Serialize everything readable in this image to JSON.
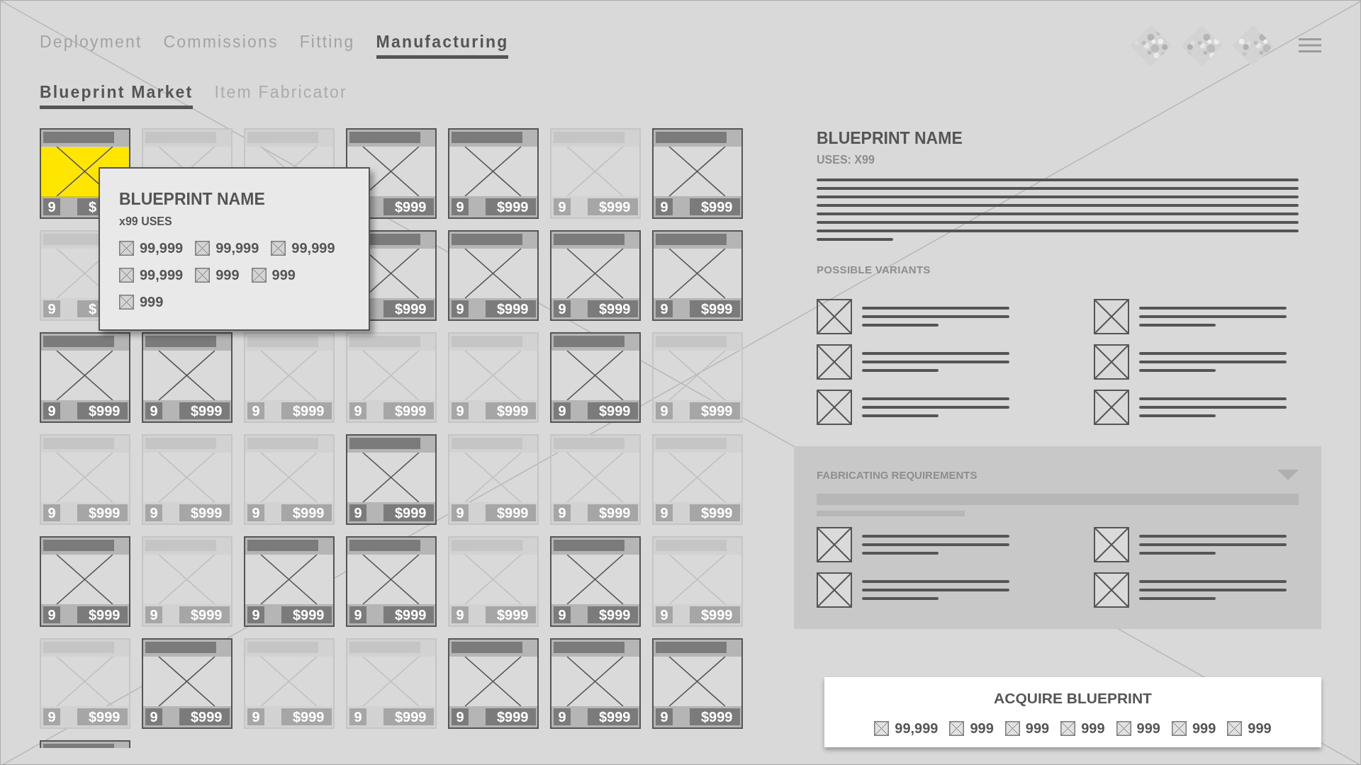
{
  "tabs": [
    {
      "label": "Deployment",
      "selected": false
    },
    {
      "label": "Commissions",
      "selected": false
    },
    {
      "label": "Fitting",
      "selected": false
    },
    {
      "label": "Manufacturing",
      "selected": true
    }
  ],
  "sub_tabs": [
    {
      "label": "Blueprint Market",
      "selected": true
    },
    {
      "label": "Item Fabricator",
      "selected": false
    }
  ],
  "blueprint_grid": {
    "rows": [
      [
        {
          "available": true,
          "selected": true,
          "count": "9",
          "price": "$"
        },
        {
          "available": false,
          "selected": false
        },
        {
          "available": false,
          "selected": false
        },
        {
          "available": true,
          "selected": false,
          "price": "$999"
        },
        {
          "available": true,
          "selected": false,
          "count": "9",
          "price": "$999"
        },
        {
          "available": false,
          "selected": false,
          "count": "9",
          "price": "$999"
        },
        {
          "available": true,
          "selected": false,
          "count": "9",
          "price": "$999"
        }
      ],
      [
        {
          "available": false,
          "selected": false,
          "count": "9",
          "price": "$"
        },
        null,
        null,
        {
          "available": true,
          "selected": false,
          "price": "$999"
        },
        {
          "available": true,
          "selected": false,
          "count": "9",
          "price": "$999"
        },
        {
          "available": true,
          "selected": false,
          "count": "9",
          "price": "$999"
        },
        {
          "available": true,
          "selected": false,
          "count": "9",
          "price": "$999"
        }
      ],
      [
        {
          "available": true,
          "selected": false,
          "count": "9",
          "price": "$999"
        },
        {
          "available": true,
          "selected": false,
          "count": "9",
          "price": "$999"
        },
        {
          "available": false,
          "selected": false,
          "count": "9",
          "price": "$999"
        },
        {
          "available": false,
          "selected": false,
          "count": "9",
          "price": "$999"
        },
        {
          "available": false,
          "selected": false,
          "count": "9",
          "price": "$999"
        },
        {
          "available": true,
          "selected": false,
          "count": "9",
          "price": "$999"
        },
        {
          "available": false,
          "selected": false,
          "count": "9",
          "price": "$999"
        }
      ],
      [
        {
          "available": false,
          "selected": false,
          "count": "9",
          "price": "$999"
        },
        {
          "available": false,
          "selected": false,
          "count": "9",
          "price": "$999"
        },
        {
          "available": false,
          "selected": false,
          "count": "9",
          "price": "$999"
        },
        {
          "available": true,
          "selected": false,
          "count": "9",
          "price": "$999"
        },
        {
          "available": false,
          "selected": false,
          "count": "9",
          "price": "$999"
        },
        {
          "available": false,
          "selected": false,
          "count": "9",
          "price": "$999"
        },
        {
          "available": false,
          "selected": false,
          "count": "9",
          "price": "$999"
        }
      ],
      [
        {
          "available": true,
          "selected": false,
          "count": "9",
          "price": "$999"
        },
        {
          "available": false,
          "selected": false,
          "count": "9",
          "price": "$999"
        },
        {
          "available": true,
          "selected": false,
          "count": "9",
          "price": "$999"
        },
        {
          "available": true,
          "selected": false,
          "count": "9",
          "price": "$999"
        },
        {
          "available": false,
          "selected": false,
          "count": "9",
          "price": "$999"
        },
        {
          "available": true,
          "selected": false,
          "count": "9",
          "price": "$999"
        },
        {
          "available": false,
          "selected": false,
          "count": "9",
          "price": "$999"
        }
      ],
      [
        {
          "available": false,
          "selected": false,
          "count": "9",
          "price": "$999"
        },
        {
          "available": true,
          "selected": false,
          "count": "9",
          "price": "$999"
        },
        {
          "available": false,
          "selected": false,
          "count": "9",
          "price": "$999"
        },
        {
          "available": false,
          "selected": false,
          "count": "9",
          "price": "$999"
        },
        {
          "available": true,
          "selected": false,
          "count": "9",
          "price": "$999"
        },
        {
          "available": true,
          "selected": false,
          "count": "9",
          "price": "$999"
        },
        {
          "available": true,
          "selected": false,
          "count": "9",
          "price": "$999"
        }
      ],
      [
        {
          "available": true
        }
      ]
    ]
  },
  "tooltip": {
    "title": "BLUEPRINT NAME",
    "uses": "x99 USES",
    "costs": [
      "99,999",
      "99,999",
      "99,999",
      "99,999",
      "999",
      "999",
      "999"
    ]
  },
  "details": {
    "title": "BLUEPRINT NAME",
    "uses": "USES: X99",
    "variants_heading": "POSSIBLE VARIANTS",
    "variants": [
      {
        "kind": "placeholder"
      },
      {
        "kind": "placeholder"
      },
      {
        "kind": "placeholder"
      },
      {
        "kind": "placeholder"
      },
      {
        "kind": "placeholder"
      },
      {
        "kind": "placeholder"
      }
    ]
  },
  "requirements": {
    "heading": "FABRICATING REQUIREMENTS",
    "expanded": true,
    "items": [
      {
        "kind": "placeholder"
      },
      {
        "kind": "placeholder"
      },
      {
        "kind": "placeholder"
      },
      {
        "kind": "placeholder"
      }
    ]
  },
  "acquire_button": {
    "label": "ACQUIRE BLUEPRINT",
    "costs": [
      "99,999",
      "999",
      "999",
      "999",
      "999",
      "999",
      "999"
    ]
  }
}
